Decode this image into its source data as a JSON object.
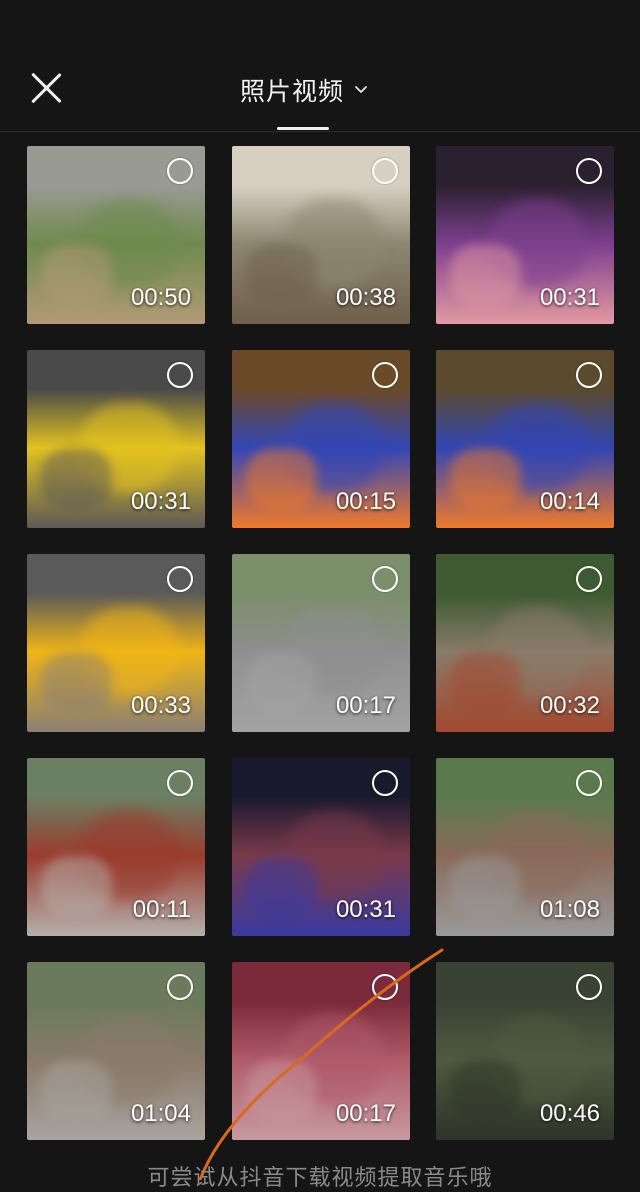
{
  "header": {
    "title": "照片视频",
    "close_icon": "close-icon",
    "dropdown_icon": "chevron-down-icon"
  },
  "videos": [
    {
      "duration": "00:50",
      "colors": [
        "#9a9a94",
        "#6f8a4e",
        "#b39a78"
      ]
    },
    {
      "duration": "00:38",
      "colors": [
        "#d7d0c2",
        "#8d8771",
        "#6e5f4a"
      ]
    },
    {
      "duration": "00:31",
      "colors": [
        "#2a2130",
        "#7d3f8e",
        "#e49aa3"
      ]
    },
    {
      "duration": "00:31",
      "colors": [
        "#4a4a4a",
        "#e3c21f",
        "#5d5a57"
      ]
    },
    {
      "duration": "00:15",
      "colors": [
        "#6b4a2a",
        "#3246b5",
        "#f07a2a"
      ]
    },
    {
      "duration": "00:14",
      "colors": [
        "#5b4a2e",
        "#3245b3",
        "#ee7a2a"
      ]
    },
    {
      "duration": "00:33",
      "colors": [
        "#5a5a5a",
        "#f0b516",
        "#8a7f73"
      ]
    },
    {
      "duration": "00:17",
      "colors": [
        "#7b8f6a",
        "#8f8f8f",
        "#a3a3a3"
      ]
    },
    {
      "duration": "00:32",
      "colors": [
        "#3d5a32",
        "#8a7b6a",
        "#a3482f"
      ]
    },
    {
      "duration": "00:11",
      "colors": [
        "#6b7f62",
        "#9a3b2e",
        "#b5b0ab"
      ]
    },
    {
      "duration": "00:31",
      "colors": [
        "#1a1a2e",
        "#7a3a4a",
        "#3a3aa0"
      ]
    },
    {
      "duration": "01:08",
      "colors": [
        "#5a7a4e",
        "#8a6a5a",
        "#9a9a9a"
      ]
    },
    {
      "duration": "01:04",
      "colors": [
        "#6a7a5a",
        "#8a7a6a",
        "#a8a49f"
      ]
    },
    {
      "duration": "00:17",
      "colors": [
        "#7a2a3a",
        "#b05a6a",
        "#c89aa0"
      ]
    },
    {
      "duration": "00:46",
      "colors": [
        "#3a4234",
        "#4f5a40",
        "#2e3428"
      ]
    }
  ],
  "footer": {
    "hint": "可尝试从抖音下载视频提取音乐哦"
  },
  "colors": {
    "background": "#151515",
    "annotation_stroke": "#d9691e"
  }
}
